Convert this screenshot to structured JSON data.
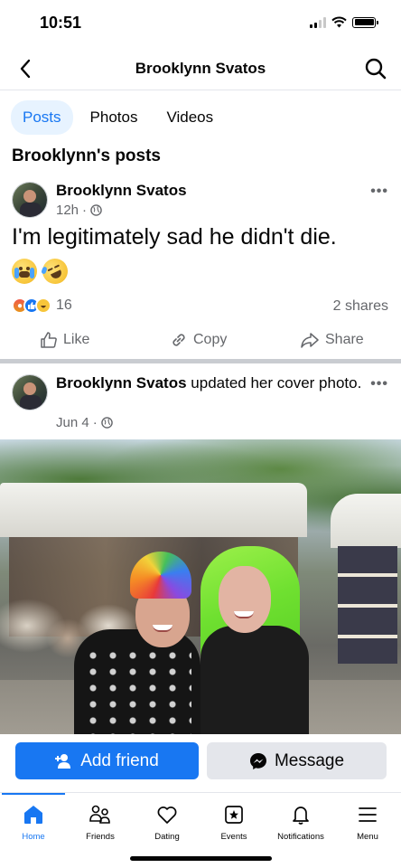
{
  "status_bar": {
    "time": "10:51"
  },
  "header": {
    "title": "Brooklynn Svatos"
  },
  "tabs": [
    {
      "label": "Posts",
      "active": true
    },
    {
      "label": "Photos",
      "active": false
    },
    {
      "label": "Videos",
      "active": false
    }
  ],
  "section_title": "Brooklynn's posts",
  "post1": {
    "author": "Brooklynn Svatos",
    "time": "12h",
    "text": "I'm legitimately sad he didn't die.",
    "emojis": [
      "loudly-crying-face",
      "rolling-on-the-floor-laughing"
    ],
    "reaction_count": "16",
    "shares": "2 shares",
    "actions": {
      "like": "Like",
      "copy": "Copy",
      "share": "Share"
    }
  },
  "post2": {
    "author": "Brooklynn Svatos",
    "action_text": "updated her cover photo.",
    "time": "Jun 4"
  },
  "profile_actions": {
    "add_friend": "Add friend",
    "message": "Message"
  },
  "bottom_nav": [
    {
      "label": "Home",
      "icon": "home-icon",
      "active": true
    },
    {
      "label": "Friends",
      "icon": "friends-icon",
      "active": false
    },
    {
      "label": "Dating",
      "icon": "dating-icon",
      "active": false
    },
    {
      "label": "Events",
      "icon": "events-icon",
      "active": false
    },
    {
      "label": "Notifications",
      "icon": "bell-icon",
      "active": false
    },
    {
      "label": "Menu",
      "icon": "menu-icon",
      "active": false
    }
  ],
  "colors": {
    "accent": "#1877f2",
    "secondary_text": "#65676b",
    "button_gray": "#e4e6eb"
  }
}
